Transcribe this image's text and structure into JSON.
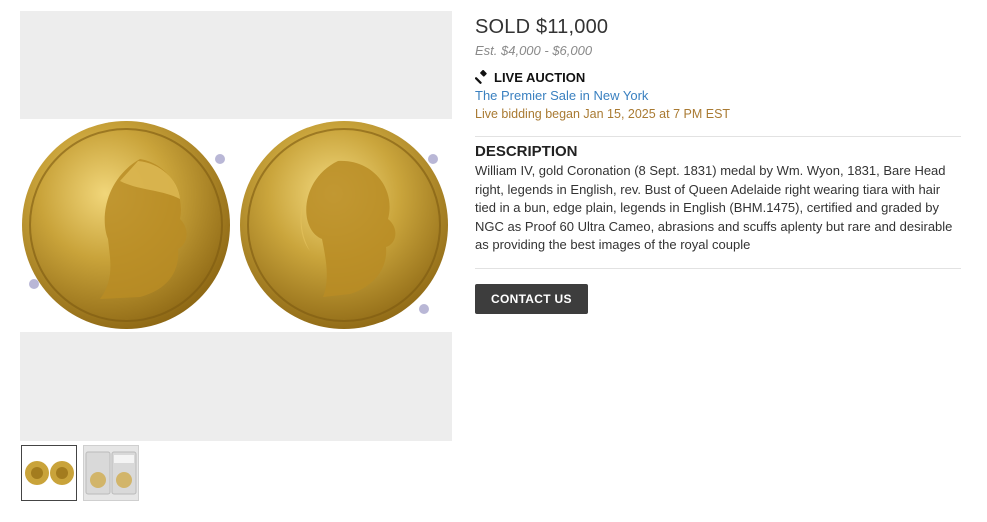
{
  "lot": {
    "sold_label": "SOLD $11,000",
    "estimate": "Est. $4,000 - $6,000",
    "auction_type": "LIVE AUCTION",
    "sale_name": "The Premier Sale in New York",
    "bidding_note": "Live bidding began Jan 15, 2025 at 7 PM EST"
  },
  "description": {
    "title": "DESCRIPTION",
    "body": "William IV, gold Coronation (8 Sept. 1831) medal by Wm. Wyon, 1831, Bare Head right, legends in English, rev. Bust of Queen Adelaide right wearing tiara with hair tied in a bun, edge plain, legends in English (BHM.1475), certified and graded by NGC as Proof 60 Ultra Cameo, abrasions and scuffs aplenty but rare and desirable as providing the best images of the royal couple"
  },
  "actions": {
    "contact_label": "CONTACT US"
  },
  "gallery": {
    "main_image": "gold-medal-obverse-reverse",
    "thumbnails": [
      "medal-pair-thumbnail",
      "ngc-slab-thumbnail"
    ],
    "active_thumbnail": 0
  },
  "icons": {
    "auction": "gavel-icon"
  },
  "colors": {
    "link": "#3a80c0",
    "note": "#a97a32",
    "button": "#3d3d3d",
    "gold": "#c9a33a"
  }
}
